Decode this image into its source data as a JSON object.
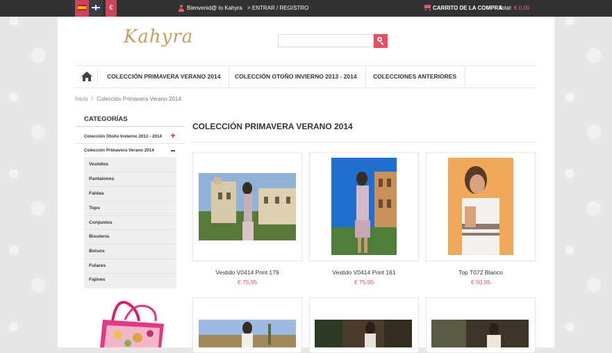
{
  "topbar": {
    "currency_symbol": "€",
    "welcome": "Bienvenid@ to Kahyra",
    "login": "> ENTRAR / REGISTRO",
    "cart_label": "CARRITO DE LA COMPRA",
    "cart_separator": "-",
    "total_label": "Total:",
    "total_value": "€ 0,00",
    "colors": {
      "bar": "#333132",
      "accent": "#c9465a"
    }
  },
  "header": {
    "logo_text": "Kahyra",
    "search_placeholder": ""
  },
  "nav": {
    "items": [
      {
        "label": "COLECCIÓN PRIMAVERA VERANO 2014"
      },
      {
        "label": "COLECCIÓN OTOÑO INVIERNO 2013 - 2014"
      },
      {
        "label": "COLECCIONES ANTERIORES"
      }
    ]
  },
  "breadcrumb": {
    "home": "Inicio",
    "separator": "/",
    "current": "Colección Primavera Verano 2014"
  },
  "sidebar": {
    "heading": "CATEGORÍAS",
    "categories": [
      {
        "label": "Colección Otoño Invierno 2013 - 2014",
        "state": "collapsed"
      },
      {
        "label": "Colección Primavera Verano 2014",
        "state": "expanded"
      }
    ],
    "subcategories": [
      "Vestidos",
      "Pantalones",
      "Faldas",
      "Tops",
      "Conjuntos",
      "Bisutería",
      "Bolsos",
      "Fulares",
      "Fajines"
    ]
  },
  "main": {
    "title": "COLECCIÓN PRIMAVERA VERANO 2014",
    "products": [
      {
        "name": "Vestido V0414 Print 179",
        "price": "€ 75,95"
      },
      {
        "name": "Vestido V0414 Print 161",
        "price": "€ 75,95"
      },
      {
        "name": "Top T072 Blanco",
        "price": "€ 50,95"
      }
    ]
  },
  "colors": {
    "price": "#e8505f",
    "logo": "#c69f5d"
  }
}
